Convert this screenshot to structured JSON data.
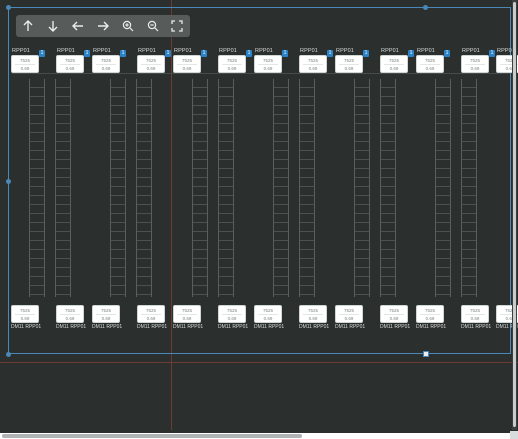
{
  "toolbar": {
    "buttons": [
      {
        "name": "move-up-button",
        "icon": "arrow-up-icon",
        "glyph": "↑"
      },
      {
        "name": "move-down-button",
        "icon": "arrow-down-icon",
        "glyph": "↓"
      },
      {
        "name": "move-left-button",
        "icon": "arrow-left-icon",
        "glyph": "←"
      },
      {
        "name": "move-right-button",
        "icon": "arrow-right-icon",
        "glyph": "→"
      },
      {
        "name": "zoom-in-button",
        "icon": "zoom-in-icon",
        "glyph": "+"
      },
      {
        "name": "zoom-out-button",
        "icon": "zoom-out-icon",
        "glyph": "−"
      },
      {
        "name": "fit-screen-button",
        "icon": "expand-icon",
        "glyph": "⤢"
      }
    ]
  },
  "bays": {
    "header_label": "RPP01",
    "badge_text": "1",
    "card_value_top": "7525",
    "card_value_bottom": "0.69",
    "footer_label": "DM11 RPP01",
    "count": 13
  },
  "colors": {
    "background": "#2b2f2e",
    "selection": "#4a88b8",
    "badge": "#2a82c9",
    "guide": "#6e3a34"
  }
}
